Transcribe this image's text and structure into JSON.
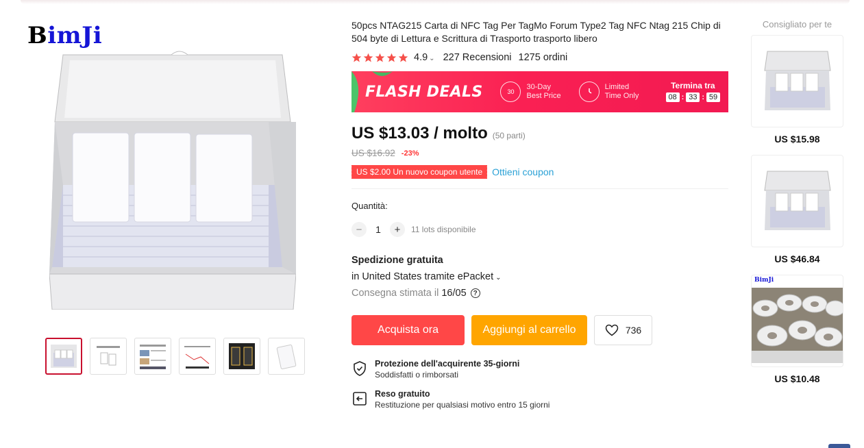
{
  "brand": {
    "logo_part1": "B",
    "logo_part2": "imJi"
  },
  "product": {
    "title": "50pcs NTAG215 Carta di NFC Tag Per TagMo Forum Type2 Tag NFC Ntag 215 Chip di 504 byte di Lettura e Scrittura di Trasporto trasporto libero",
    "rating": "4.9",
    "reviews": "227 Recensioni",
    "orders": "1275 ordini"
  },
  "flash_deals": {
    "title": "FLASH DEALS",
    "badge_num": "30",
    "item1_line1": "30-Day",
    "item1_line2": "Best Price",
    "item2_line1": "Limited",
    "item2_line2": "Time Only",
    "countdown_label": "Termina tra",
    "hours": "08",
    "minutes": "33",
    "seconds": "59"
  },
  "pricing": {
    "price": "US $13.03 / molto",
    "parts": "(50 parti)",
    "old_price": "US $16.92",
    "discount": "-23%",
    "coupon": "US $2.00 Un nuovo coupon utente",
    "get_coupon": "Ottieni coupon"
  },
  "quantity": {
    "label": "Quantità:",
    "minus": "−",
    "value": "1",
    "plus": "+",
    "stock": "11 lots disponibile"
  },
  "shipping": {
    "title": "Spedizione gratuita",
    "via": "in United States tramite ePacket",
    "estimate_label": "Consegna stimata il",
    "estimate_date": "16/05",
    "help_symbol": "?"
  },
  "actions": {
    "buy_now": "Acquista ora",
    "add_to_cart": "Aggiungi al carrello",
    "wishlist_count": "736"
  },
  "guarantees": {
    "protection_title": "Protezione dell'acquirente 35-giorni",
    "protection_sub": "Soddisfatti o rimborsati",
    "return_title": "Reso gratuito",
    "return_sub": "Restituzione per qualsiasi motivo entro 15 giorni"
  },
  "recommendations": {
    "title": "Consigliato per te",
    "items": [
      {
        "price": "US $15.98"
      },
      {
        "price": "US $46.84"
      },
      {
        "price": "US $10.48",
        "logo": "BimJi"
      }
    ]
  },
  "colors": {
    "accent_red": "#ff4747",
    "cart_orange": "#ffa500",
    "flash_pink": "#fa2053",
    "link_blue": "#2aa1d6",
    "star": "#f5504a"
  },
  "icons": [
    "star-icon",
    "chevron-down-icon",
    "clock-icon",
    "heart-icon",
    "shield-check-icon",
    "return-icon",
    "help-icon"
  ]
}
